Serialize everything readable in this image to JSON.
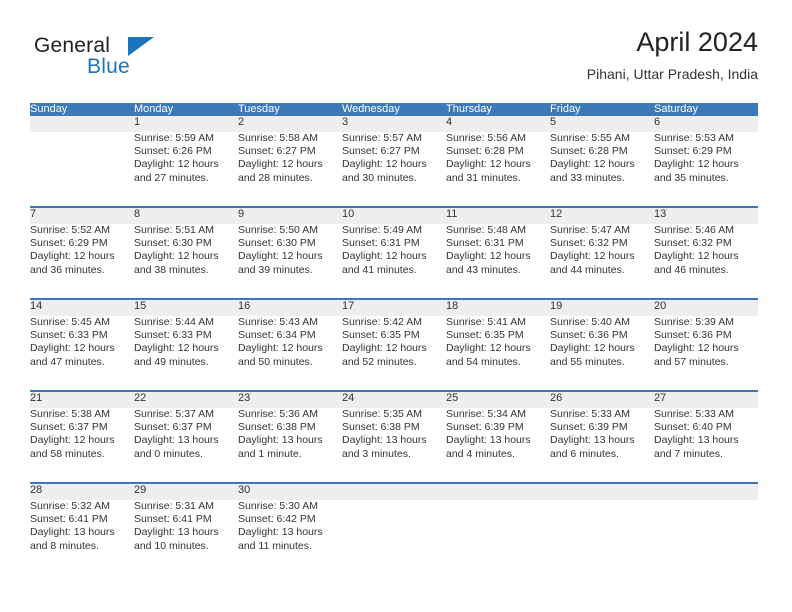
{
  "brand": {
    "name_part1": "General",
    "name_part2": "Blue",
    "colors": {
      "dark": "#231f20",
      "blue": "#1b75bb"
    }
  },
  "header": {
    "title": "April 2024",
    "subtitle": "Pihani, Uttar Pradesh, India"
  },
  "calendar": {
    "header_color": "#3b79b9",
    "daynum_bg": "#eeeeee",
    "day_names": [
      "Sunday",
      "Monday",
      "Tuesday",
      "Wednesday",
      "Thursday",
      "Friday",
      "Saturday"
    ],
    "weeks": [
      [
        {
          "day": "",
          "sunrise": "",
          "sunset": "",
          "daylight_line1": "",
          "daylight_line2": ""
        },
        {
          "day": "1",
          "sunrise": "Sunrise: 5:59 AM",
          "sunset": "Sunset: 6:26 PM",
          "daylight_line1": "Daylight: 12 hours",
          "daylight_line2": "and 27 minutes."
        },
        {
          "day": "2",
          "sunrise": "Sunrise: 5:58 AM",
          "sunset": "Sunset: 6:27 PM",
          "daylight_line1": "Daylight: 12 hours",
          "daylight_line2": "and 28 minutes."
        },
        {
          "day": "3",
          "sunrise": "Sunrise: 5:57 AM",
          "sunset": "Sunset: 6:27 PM",
          "daylight_line1": "Daylight: 12 hours",
          "daylight_line2": "and 30 minutes."
        },
        {
          "day": "4",
          "sunrise": "Sunrise: 5:56 AM",
          "sunset": "Sunset: 6:28 PM",
          "daylight_line1": "Daylight: 12 hours",
          "daylight_line2": "and 31 minutes."
        },
        {
          "day": "5",
          "sunrise": "Sunrise: 5:55 AM",
          "sunset": "Sunset: 6:28 PM",
          "daylight_line1": "Daylight: 12 hours",
          "daylight_line2": "and 33 minutes."
        },
        {
          "day": "6",
          "sunrise": "Sunrise: 5:53 AM",
          "sunset": "Sunset: 6:29 PM",
          "daylight_line1": "Daylight: 12 hours",
          "daylight_line2": "and 35 minutes."
        }
      ],
      [
        {
          "day": "7",
          "sunrise": "Sunrise: 5:52 AM",
          "sunset": "Sunset: 6:29 PM",
          "daylight_line1": "Daylight: 12 hours",
          "daylight_line2": "and 36 minutes."
        },
        {
          "day": "8",
          "sunrise": "Sunrise: 5:51 AM",
          "sunset": "Sunset: 6:30 PM",
          "daylight_line1": "Daylight: 12 hours",
          "daylight_line2": "and 38 minutes."
        },
        {
          "day": "9",
          "sunrise": "Sunrise: 5:50 AM",
          "sunset": "Sunset: 6:30 PM",
          "daylight_line1": "Daylight: 12 hours",
          "daylight_line2": "and 39 minutes."
        },
        {
          "day": "10",
          "sunrise": "Sunrise: 5:49 AM",
          "sunset": "Sunset: 6:31 PM",
          "daylight_line1": "Daylight: 12 hours",
          "daylight_line2": "and 41 minutes."
        },
        {
          "day": "11",
          "sunrise": "Sunrise: 5:48 AM",
          "sunset": "Sunset: 6:31 PM",
          "daylight_line1": "Daylight: 12 hours",
          "daylight_line2": "and 43 minutes."
        },
        {
          "day": "12",
          "sunrise": "Sunrise: 5:47 AM",
          "sunset": "Sunset: 6:32 PM",
          "daylight_line1": "Daylight: 12 hours",
          "daylight_line2": "and 44 minutes."
        },
        {
          "day": "13",
          "sunrise": "Sunrise: 5:46 AM",
          "sunset": "Sunset: 6:32 PM",
          "daylight_line1": "Daylight: 12 hours",
          "daylight_line2": "and 46 minutes."
        }
      ],
      [
        {
          "day": "14",
          "sunrise": "Sunrise: 5:45 AM",
          "sunset": "Sunset: 6:33 PM",
          "daylight_line1": "Daylight: 12 hours",
          "daylight_line2": "and 47 minutes."
        },
        {
          "day": "15",
          "sunrise": "Sunrise: 5:44 AM",
          "sunset": "Sunset: 6:33 PM",
          "daylight_line1": "Daylight: 12 hours",
          "daylight_line2": "and 49 minutes."
        },
        {
          "day": "16",
          "sunrise": "Sunrise: 5:43 AM",
          "sunset": "Sunset: 6:34 PM",
          "daylight_line1": "Daylight: 12 hours",
          "daylight_line2": "and 50 minutes."
        },
        {
          "day": "17",
          "sunrise": "Sunrise: 5:42 AM",
          "sunset": "Sunset: 6:35 PM",
          "daylight_line1": "Daylight: 12 hours",
          "daylight_line2": "and 52 minutes."
        },
        {
          "day": "18",
          "sunrise": "Sunrise: 5:41 AM",
          "sunset": "Sunset: 6:35 PM",
          "daylight_line1": "Daylight: 12 hours",
          "daylight_line2": "and 54 minutes."
        },
        {
          "day": "19",
          "sunrise": "Sunrise: 5:40 AM",
          "sunset": "Sunset: 6:36 PM",
          "daylight_line1": "Daylight: 12 hours",
          "daylight_line2": "and 55 minutes."
        },
        {
          "day": "20",
          "sunrise": "Sunrise: 5:39 AM",
          "sunset": "Sunset: 6:36 PM",
          "daylight_line1": "Daylight: 12 hours",
          "daylight_line2": "and 57 minutes."
        }
      ],
      [
        {
          "day": "21",
          "sunrise": "Sunrise: 5:38 AM",
          "sunset": "Sunset: 6:37 PM",
          "daylight_line1": "Daylight: 12 hours",
          "daylight_line2": "and 58 minutes."
        },
        {
          "day": "22",
          "sunrise": "Sunrise: 5:37 AM",
          "sunset": "Sunset: 6:37 PM",
          "daylight_line1": "Daylight: 13 hours",
          "daylight_line2": "and 0 minutes."
        },
        {
          "day": "23",
          "sunrise": "Sunrise: 5:36 AM",
          "sunset": "Sunset: 6:38 PM",
          "daylight_line1": "Daylight: 13 hours",
          "daylight_line2": "and 1 minute."
        },
        {
          "day": "24",
          "sunrise": "Sunrise: 5:35 AM",
          "sunset": "Sunset: 6:38 PM",
          "daylight_line1": "Daylight: 13 hours",
          "daylight_line2": "and 3 minutes."
        },
        {
          "day": "25",
          "sunrise": "Sunrise: 5:34 AM",
          "sunset": "Sunset: 6:39 PM",
          "daylight_line1": "Daylight: 13 hours",
          "daylight_line2": "and 4 minutes."
        },
        {
          "day": "26",
          "sunrise": "Sunrise: 5:33 AM",
          "sunset": "Sunset: 6:39 PM",
          "daylight_line1": "Daylight: 13 hours",
          "daylight_line2": "and 6 minutes."
        },
        {
          "day": "27",
          "sunrise": "Sunrise: 5:33 AM",
          "sunset": "Sunset: 6:40 PM",
          "daylight_line1": "Daylight: 13 hours",
          "daylight_line2": "and 7 minutes."
        }
      ],
      [
        {
          "day": "28",
          "sunrise": "Sunrise: 5:32 AM",
          "sunset": "Sunset: 6:41 PM",
          "daylight_line1": "Daylight: 13 hours",
          "daylight_line2": "and 8 minutes."
        },
        {
          "day": "29",
          "sunrise": "Sunrise: 5:31 AM",
          "sunset": "Sunset: 6:41 PM",
          "daylight_line1": "Daylight: 13 hours",
          "daylight_line2": "and 10 minutes."
        },
        {
          "day": "30",
          "sunrise": "Sunrise: 5:30 AM",
          "sunset": "Sunset: 6:42 PM",
          "daylight_line1": "Daylight: 13 hours",
          "daylight_line2": "and 11 minutes."
        },
        {
          "day": "",
          "sunrise": "",
          "sunset": "",
          "daylight_line1": "",
          "daylight_line2": ""
        },
        {
          "day": "",
          "sunrise": "",
          "sunset": "",
          "daylight_line1": "",
          "daylight_line2": ""
        },
        {
          "day": "",
          "sunrise": "",
          "sunset": "",
          "daylight_line1": "",
          "daylight_line2": ""
        },
        {
          "day": "",
          "sunrise": "",
          "sunset": "",
          "daylight_line1": "",
          "daylight_line2": ""
        }
      ]
    ]
  }
}
